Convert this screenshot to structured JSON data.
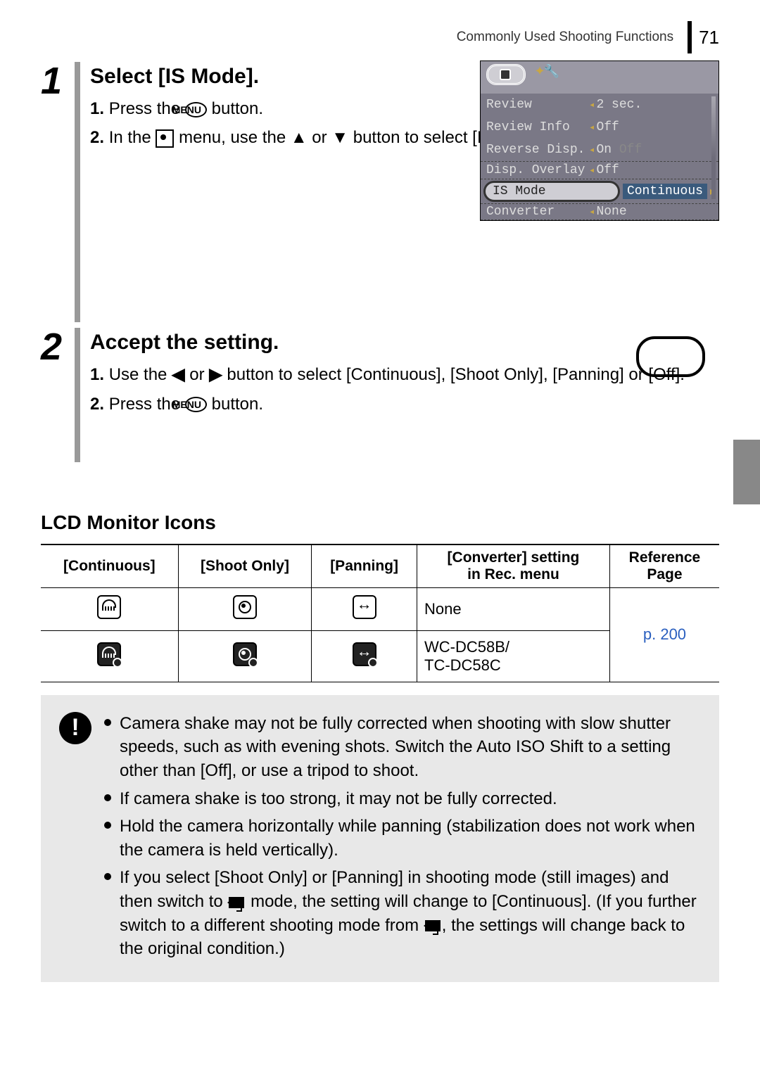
{
  "header": {
    "section": "Commonly Used Shooting Functions",
    "page": "71"
  },
  "step1": {
    "title": "Select [IS Mode].",
    "i1_a": "Press the ",
    "i1_menu": "MENU",
    "i1_b": " button.",
    "i2_a": "In the ",
    "i2_b": " menu, use the ",
    "i2_c": " or ",
    "i2_d": " button to select [IS Mode]."
  },
  "screen": {
    "r1": {
      "l": "Review",
      "v": "2 sec."
    },
    "r2": {
      "l": "Review Info",
      "v": "Off"
    },
    "r3": {
      "l": "Reverse Disp.",
      "v": "On",
      "v2": "Off"
    },
    "r4": {
      "l": "Disp. Overlay",
      "v": "Off"
    },
    "sel": {
      "l": "IS Mode",
      "v": "Continuous"
    },
    "r5": {
      "l": "Converter",
      "v": "None"
    }
  },
  "step2": {
    "title": "Accept the setting.",
    "i1_a": "Use the ",
    "i1_b": " or ",
    "i1_c": " button to select [Continuous], [Shoot Only], [Panning] or [Off].",
    "i2_a": "Press the ",
    "i2_menu": "MENU",
    "i2_b": " button."
  },
  "iconsTitle": "LCD Monitor Icons",
  "table": {
    "h1": "[Continuous]",
    "h2": "[Shoot Only]",
    "h3": "[Panning]",
    "h4a": "[Converter] setting",
    "h4b": "in Rec. menu",
    "h5a": "Reference",
    "h5b": "Page",
    "r1c4": "None",
    "r2c4": "WC-DC58B/\nTC-DC58C",
    "ref": "p. 200"
  },
  "notes": {
    "n1": "Camera shake may not be fully corrected when shooting with slow shutter speeds, such as with evening shots. Switch the Auto ISO Shift to a setting other than [Off], or use a tripod to shoot.",
    "n2": "If camera shake is too strong, it may not be fully corrected.",
    "n3": "Hold the camera horizontally while panning (stabilization does not work when the camera is held vertically).",
    "n4a": "If you select [Shoot Only] or [Panning] in shooting mode (still images) and then switch to ",
    "n4b": " mode, the setting will change to [Continuous]. (If you further switch to a different shooting mode from ",
    "n4c": ", the settings will change back to the original condition.)"
  }
}
